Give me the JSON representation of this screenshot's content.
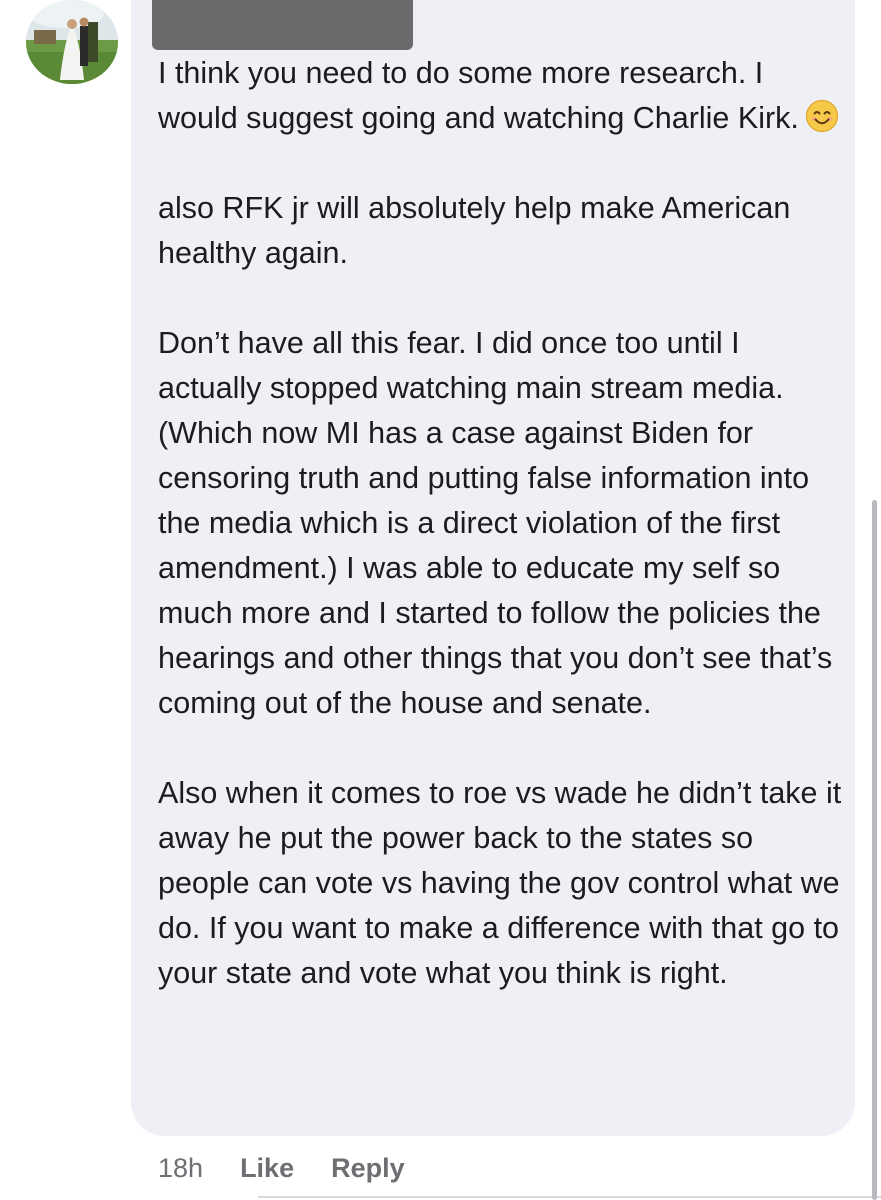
{
  "comment": {
    "paragraphs": [
      "I think you need to do some more research. I would suggest going and watching Charlie Kirk.",
      "also RFK jr will absolutely help make American healthy again.",
      "Don’t have all this fear. I did once too until I actually stopped watching main stream media. (Which now MI has a case against Biden for censoring truth and putting false information into the media which is a direct violation of the first amendment.) I was able to educate my self so much more and I started to follow the policies the hearings and other things that you don’t see that’s coming out of the house and senate.",
      "Also when it comes to roe vs wade he didn’t take it away he put the power back to the states so people can vote vs having the gov control what we do. If you want to make a difference with that go to your state and vote what you think is right."
    ],
    "emoji": "smiling-face-emoji"
  },
  "actions": {
    "timestamp": "18h",
    "like_label": "Like",
    "reply_label": "Reply"
  },
  "colors": {
    "bubble": "#eff0f5",
    "text": "#1c1c1e",
    "secondary": "#6e6e73",
    "redaction": "#6b6b6d"
  }
}
